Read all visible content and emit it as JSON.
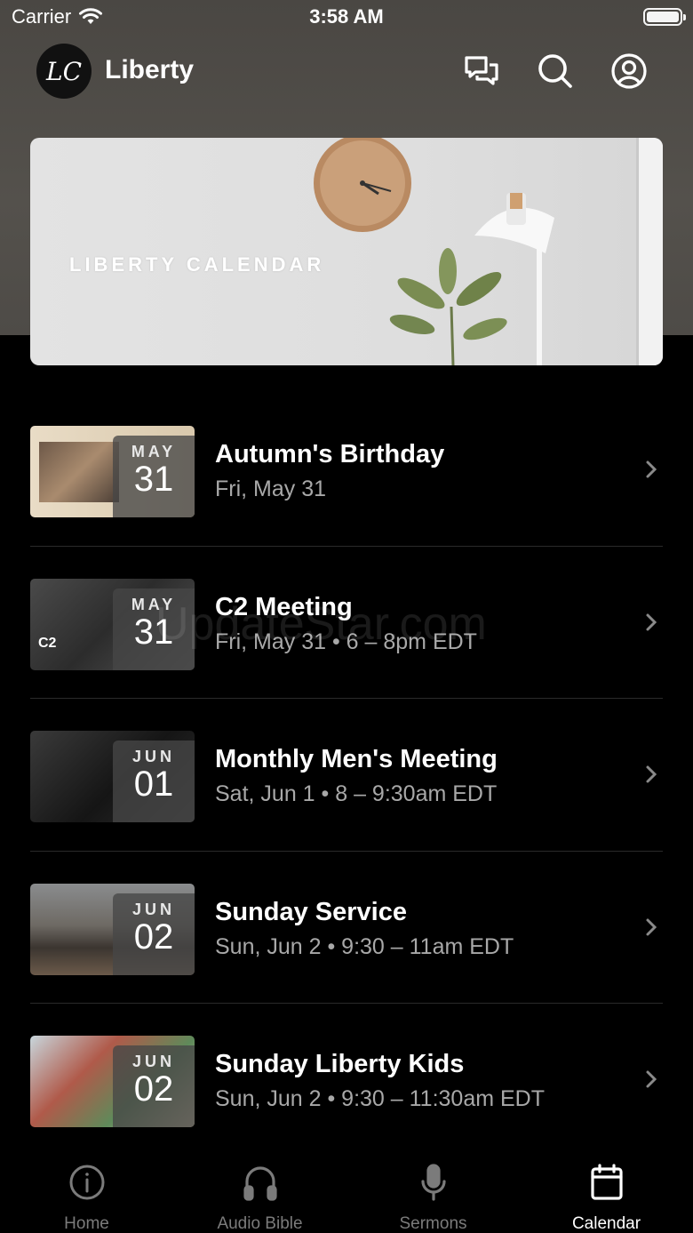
{
  "status": {
    "carrier": "Carrier",
    "time": "3:58 AM"
  },
  "header": {
    "logo_text": "LC",
    "title": "Liberty"
  },
  "banner": {
    "label": "LIBERTY CALENDAR"
  },
  "events": [
    {
      "month": "MAY",
      "day": "31",
      "title": "Autumn's Birthday",
      "subtitle": "Fri, May 31"
    },
    {
      "month": "MAY",
      "day": "31",
      "title": "C2 Meeting",
      "subtitle": "Fri, May 31 • 6 – 8pm EDT"
    },
    {
      "month": "JUN",
      "day": "01",
      "title": "Monthly Men's Meeting",
      "subtitle": "Sat, Jun 1 • 8 – 9:30am EDT"
    },
    {
      "month": "JUN",
      "day": "02",
      "title": "Sunday Service",
      "subtitle": "Sun, Jun 2 • 9:30 – 11am EDT"
    },
    {
      "month": "JUN",
      "day": "02",
      "title": "Sunday Liberty Kids",
      "subtitle": "Sun, Jun 2 • 9:30 – 11:30am EDT"
    }
  ],
  "watermark": "UpdateStar.com",
  "tabs": [
    {
      "label": "Home",
      "icon": "info-icon"
    },
    {
      "label": "Audio Bible",
      "icon": "headphones-icon"
    },
    {
      "label": "Sermons",
      "icon": "microphone-icon"
    },
    {
      "label": "Calendar",
      "icon": "calendar-icon"
    }
  ],
  "active_tab": "Calendar"
}
